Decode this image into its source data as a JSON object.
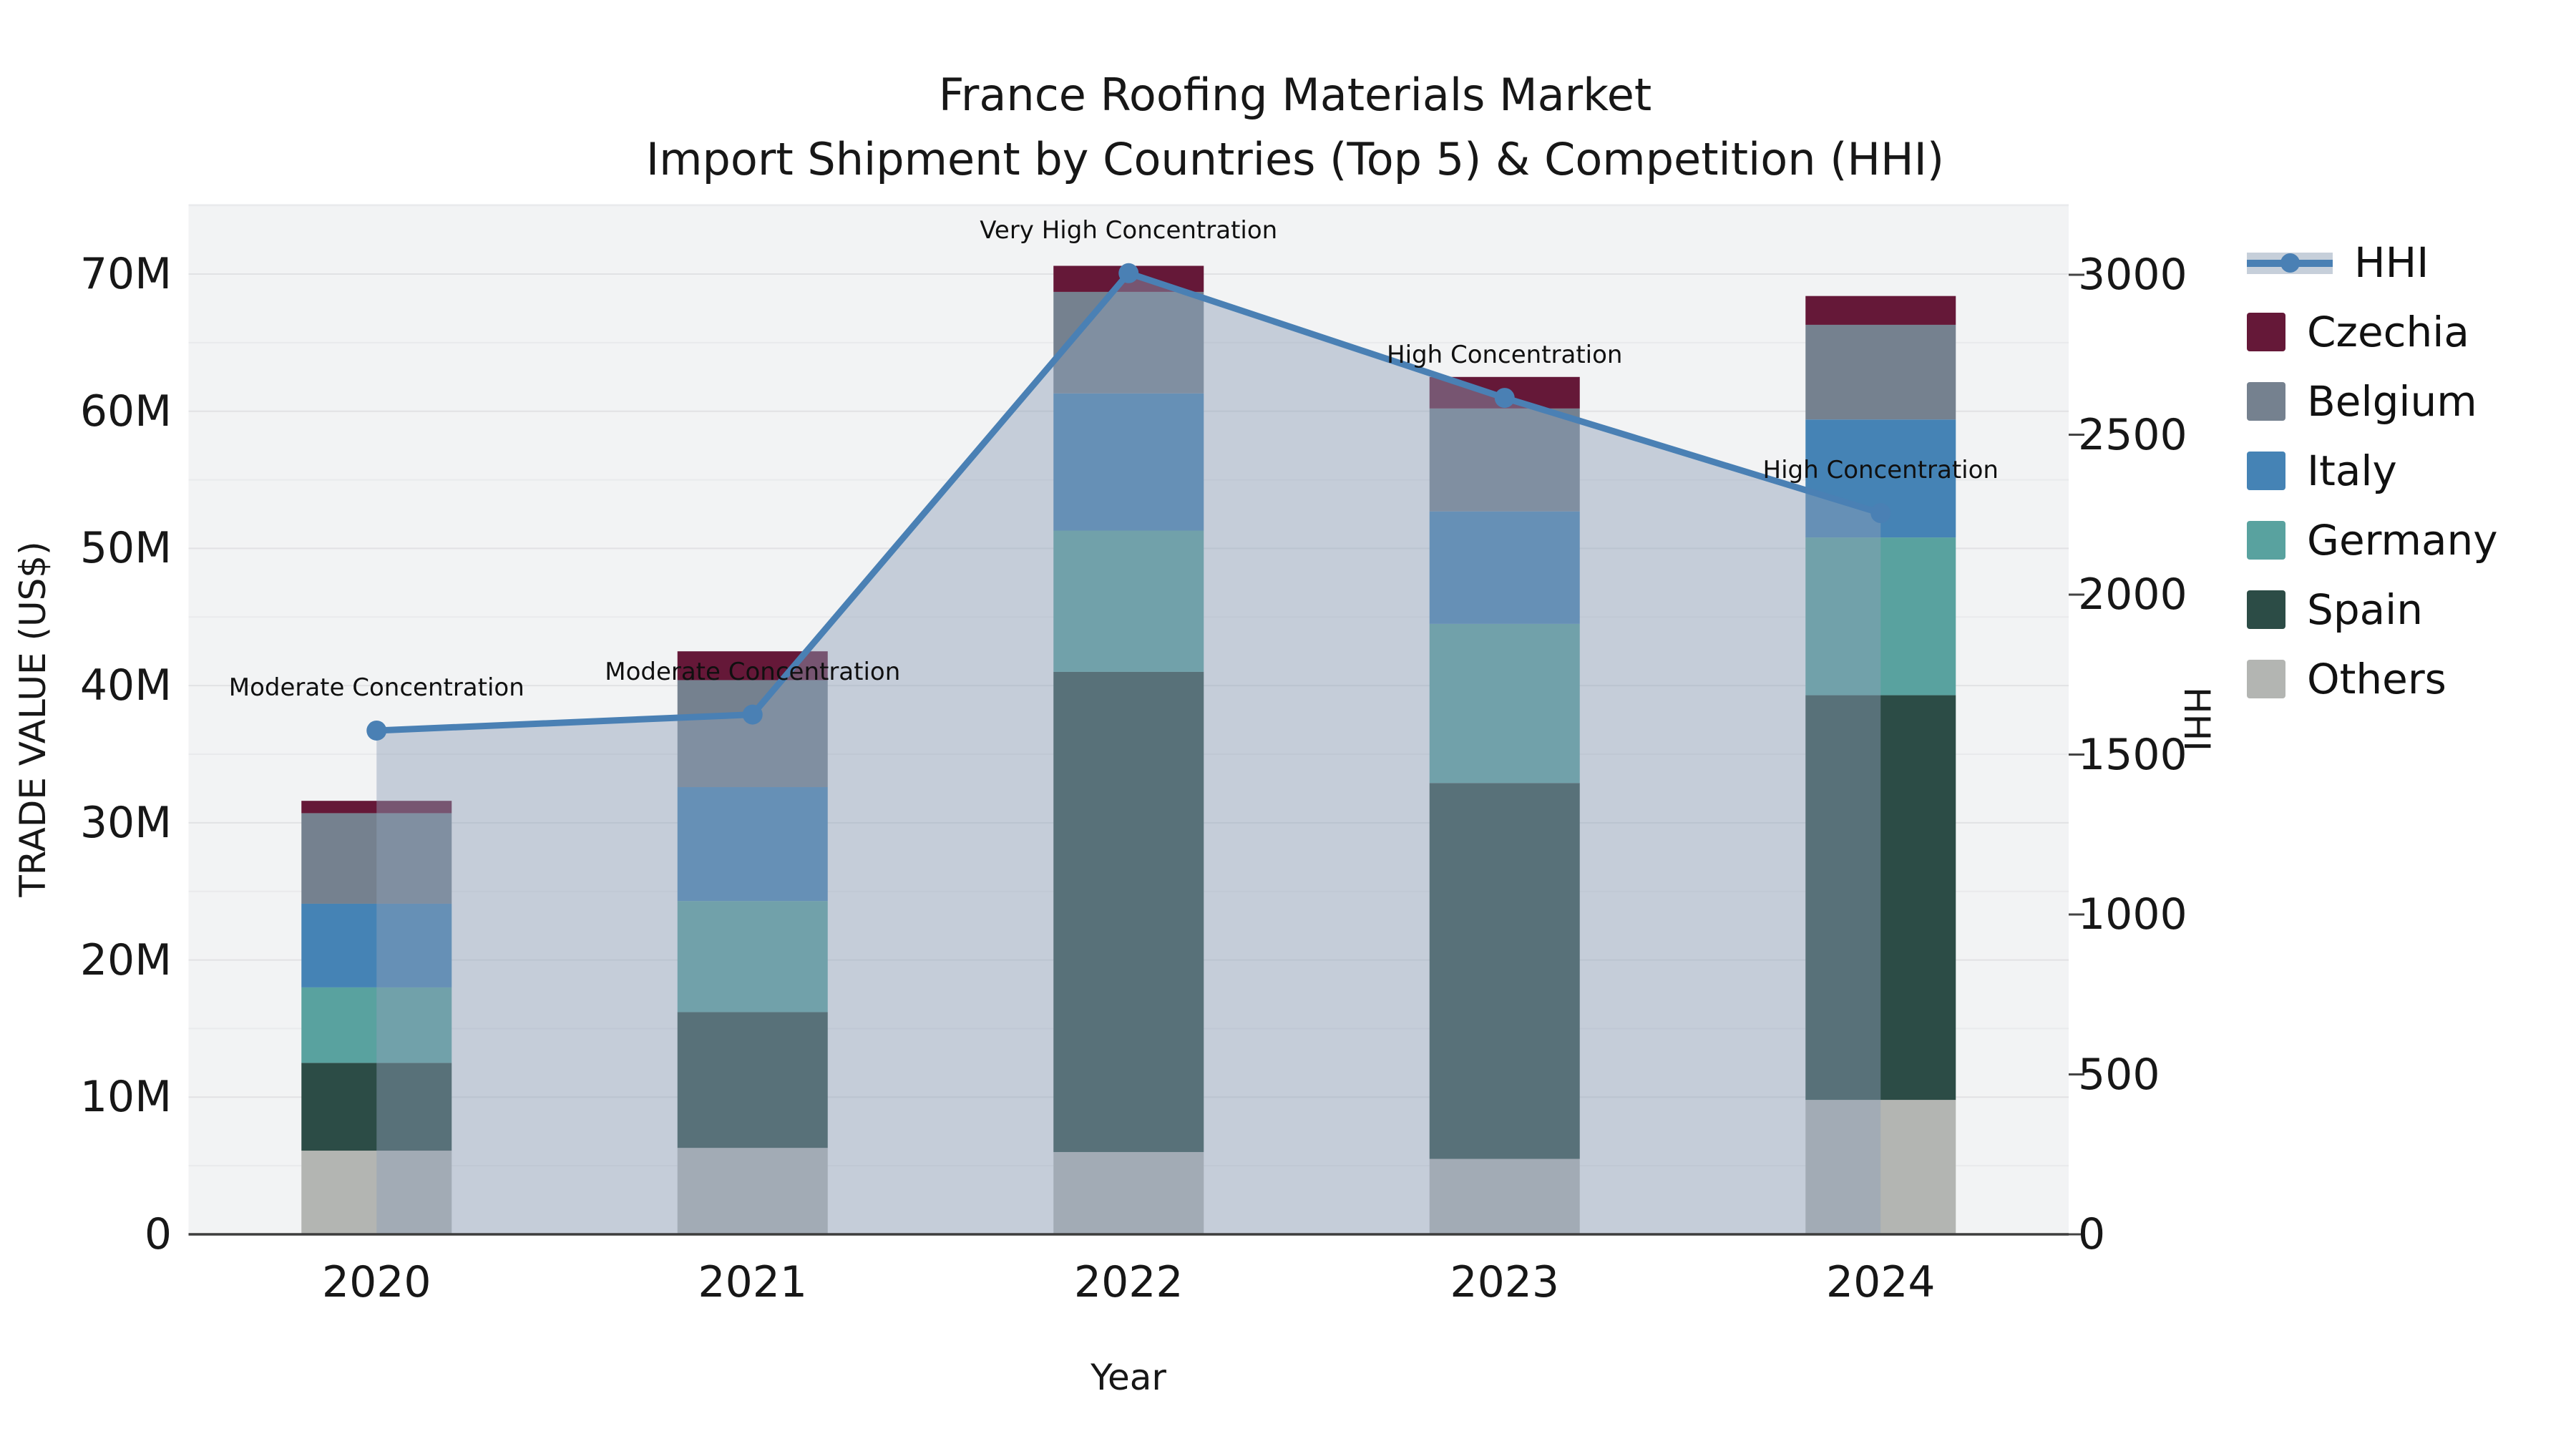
{
  "title": {
    "line1": "France Roofing Materials Market",
    "line2": "Import Shipment by Countries (Top 5) & Competition (HHI)"
  },
  "chart_data": {
    "type": "bar",
    "stacked": true,
    "categories": [
      "2020",
      "2021",
      "2022",
      "2023",
      "2024"
    ],
    "value_unit": "million US$",
    "xlabel": "Year",
    "ylabel": "TRADE VALUE (US$)",
    "y2label": "HHI",
    "ylim": [
      0,
      75
    ],
    "y2lim": [
      0,
      3220
    ],
    "grid": "horizontal light gridlines every 5M on gray plot background",
    "legend_position": "right",
    "yticks": [
      "0",
      "10M",
      "20M",
      "30M",
      "40M",
      "50M",
      "60M",
      "70M"
    ],
    "y2ticks": [
      "0",
      "500",
      "1000",
      "1500",
      "2000",
      "2500",
      "3000"
    ],
    "series": [
      {
        "name": "Others",
        "color": "#b3b5b2",
        "values": [
          6.1,
          6.3,
          6.0,
          5.5,
          9.8
        ]
      },
      {
        "name": "Spain",
        "color": "#2c4c46",
        "values": [
          6.4,
          9.9,
          35.0,
          27.4,
          29.5
        ]
      },
      {
        "name": "Germany",
        "color": "#59a29f",
        "values": [
          5.5,
          8.1,
          10.3,
          11.6,
          11.5
        ]
      },
      {
        "name": "Italy",
        "color": "#4583b5",
        "values": [
          6.1,
          8.3,
          10.0,
          8.2,
          8.6
        ]
      },
      {
        "name": "Belgium",
        "color": "#75818f",
        "values": [
          6.6,
          7.8,
          7.4,
          7.5,
          6.9
        ]
      },
      {
        "name": "Czechia",
        "color": "#651838",
        "values": [
          0.9,
          2.1,
          1.9,
          2.3,
          2.1
        ]
      }
    ],
    "bar_totals": [
      31.6,
      42.5,
      70.6,
      62.5,
      68.4
    ],
    "line_series": {
      "name": "HHI",
      "axis": "right",
      "color": "#4a80b4",
      "area_fill": "rgba(141,160,184,0.45)",
      "values": [
        1575,
        1625,
        3005,
        2615,
        2255
      ]
    },
    "annotations": [
      {
        "text": "Moderate Concentration",
        "year": "2020"
      },
      {
        "text": "Moderate Concentration",
        "year": "2021"
      },
      {
        "text": "Very High Concentration",
        "year": "2022"
      },
      {
        "text": "High Concentration",
        "year": "2023"
      },
      {
        "text": "High Concentration",
        "year": "2024"
      }
    ],
    "legend_order": [
      "HHI",
      "Czechia",
      "Belgium",
      "Italy",
      "Germany",
      "Spain",
      "Others"
    ]
  },
  "style": {
    "plot_bg": "#f2f3f4",
    "grid_major": "#e1e2e4",
    "grid_minor": "#e9eaec",
    "baseline": "#3d3d3d",
    "tick_mark": "#444444"
  }
}
